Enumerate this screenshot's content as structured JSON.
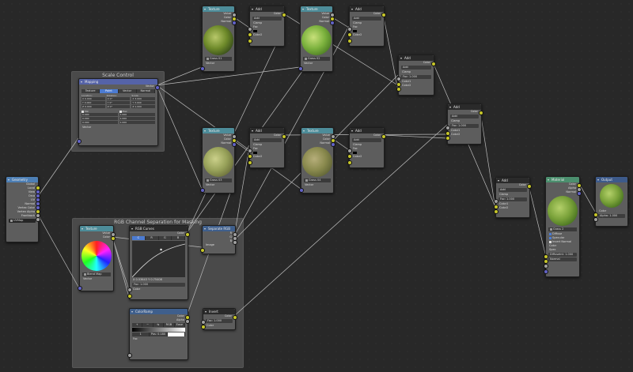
{
  "frames": {
    "scale": "Scale Control",
    "rgb": "RGB Channel Separation for Masking"
  },
  "geometry": {
    "title": "Geometry",
    "outputs": [
      "Global",
      "Local",
      "View",
      "Orco",
      "UV",
      "Normal",
      "Vertex Color",
      "Vertex Alpha",
      "Frontback"
    ],
    "uvmap": "UVMap"
  },
  "mapping": {
    "title": "Mapping",
    "output": "Vector",
    "tabs": [
      "Texture",
      "Point",
      "Vector",
      "Normal"
    ],
    "headers": [
      "Location:",
      "Rotation:",
      "Scale:"
    ],
    "loc": [
      "X 0.000",
      "Y 0.000",
      "Z 0.000"
    ],
    "rot": [
      "X 0°",
      "Y 0°",
      "Z 0°"
    ],
    "scale": [
      "X 3.000",
      "Y 3.000",
      "Z 1.000"
    ],
    "min": "Min",
    "max": "Max",
    "min_vals": [
      "0.000",
      "0.000",
      "0.000"
    ],
    "max_vals": [
      "1.000",
      "1.000",
      "1.000"
    ],
    "input": "Vector"
  },
  "tex": [
    {
      "title": "Texture",
      "outs": [
        "Value",
        "Color",
        "Normal"
      ],
      "image": "Grass 01",
      "input": "Vector"
    },
    {
      "title": "Texture",
      "outs": [
        "Value",
        "Color",
        "Normal"
      ],
      "image": "Grass 02",
      "input": "Vector"
    },
    {
      "title": "Texture",
      "outs": [
        "Value",
        "Color",
        "Normal"
      ],
      "image": "Grass 03",
      "input": "Vector"
    },
    {
      "title": "Texture",
      "outs": [
        "Value",
        "Color",
        "Normal"
      ],
      "image": "Grass 04",
      "input": "Vector"
    }
  ],
  "adds": [
    {
      "title": "Add",
      "out": "Color",
      "mode": "Add",
      "clamp": "Clamp",
      "fac": "Fac",
      "c1": "Color1",
      "c2": "Color2"
    },
    {
      "title": "Add",
      "out": "Color",
      "mode": "Add",
      "clamp": "Clamp",
      "fac": "Fac",
      "c1": "Color1",
      "c2": "Color2"
    },
    {
      "title": "Add",
      "out": "Color",
      "mode": "Add",
      "clamp": "Clamp",
      "fac": "Fac",
      "c1": "Color1",
      "c2": "Color2"
    },
    {
      "title": "Add",
      "out": "Color",
      "mode": "Add",
      "clamp": "Clamp",
      "fac": "Fac",
      "c1": "Color1",
      "c2": "Color2"
    },
    {
      "title": "Add",
      "out": "Color",
      "mode": "Add",
      "clamp": "Clamp",
      "fac": "Fac: 1.000",
      "c1": "Color1",
      "c2": "Color2"
    },
    {
      "title": "Add",
      "out": "Color",
      "mode": "Add",
      "clamp": "Clamp",
      "fac": "Fac: 1.000",
      "c1": "Color1",
      "c2": "Color2"
    },
    {
      "title": "Add",
      "out": "Color",
      "mode": "Add",
      "clamp": "Clamp",
      "fac": "Fac: 1.000",
      "c1": "Color1",
      "c2": "Color2"
    }
  ],
  "blend": {
    "title": "Texture",
    "outs": [
      "Value",
      "Color"
    ],
    "image": "Blend Map",
    "input": "Vector"
  },
  "curves": {
    "title": "RGB Curves",
    "out": "Color",
    "tabs": [
      "C",
      "R",
      "G",
      "B"
    ],
    "readout": "X 0.53643   Y 0.75408",
    "fac": "Fac: 1.000",
    "input": "Color"
  },
  "sep": {
    "title": "Separate RGB",
    "outs": [
      "R",
      "G",
      "B"
    ],
    "input": "Image"
  },
  "ramp": {
    "title": "ColorRamp",
    "outs": [
      "Color",
      "Alpha"
    ],
    "controls": [
      "+",
      "−",
      "⇆",
      "RGB",
      "Ease"
    ],
    "pos_index": "1",
    "pos": "Pos: 0.180",
    "input": "Fac"
  },
  "invert": {
    "title": "Invert",
    "out": "Color",
    "fac": "Fac: 1.000",
    "input": "Color"
  },
  "material": {
    "title": "Material",
    "outs": [
      "Color",
      "Alpha",
      "Normal"
    ],
    "name": "Grass",
    "num": "2",
    "diffuse": "Diffuse",
    "specular": "Specular",
    "invert": "Invert Normal",
    "ins": [
      "Color",
      "Spec",
      "Refl",
      "Normal"
    ],
    "refl": "DiffuseInt: 1.000",
    "normal": "Normal"
  },
  "output": {
    "title": "Output",
    "ins": [
      "Color",
      "Alpha"
    ],
    "alpha": "Alpha: 1.000"
  }
}
